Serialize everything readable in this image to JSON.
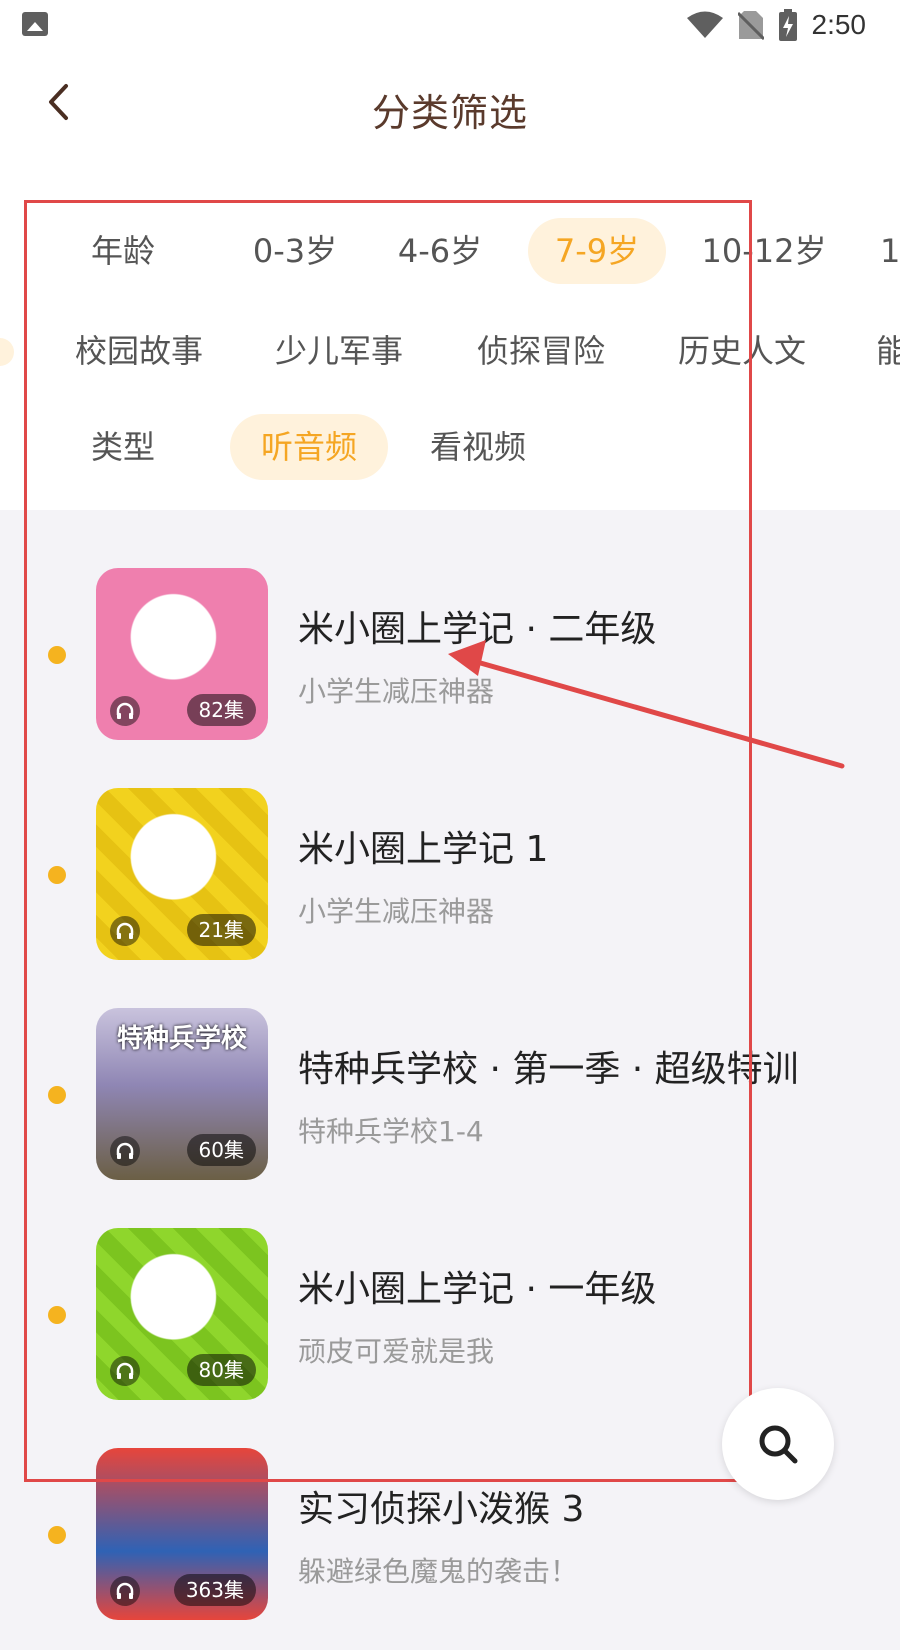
{
  "status_bar": {
    "time": "2:50"
  },
  "header": {
    "title": "分类筛选"
  },
  "filters": {
    "age": {
      "label": "年龄",
      "options": [
        "0-3岁",
        "4-6岁",
        "7-9岁",
        "10-12岁",
        "1"
      ],
      "selected": "7-9岁"
    },
    "topics": {
      "options": [
        "校园故事",
        "少儿军事",
        "侦探冒险",
        "历史人文",
        "能"
      ]
    },
    "type": {
      "label": "类型",
      "options": [
        "听音频",
        "看视频"
      ],
      "selected": "听音频"
    }
  },
  "items": [
    {
      "title": "米小圈上学记 · 二年级",
      "subtitle": "小学生减压神器",
      "episodes": "82集",
      "cover_color": "#ef7fae"
    },
    {
      "title": "米小圈上学记 1",
      "subtitle": "小学生减压神器",
      "episodes": "21集",
      "cover_color": "#f2d21e"
    },
    {
      "title": "特种兵学校 · 第一季 · 超级特训",
      "subtitle": "特种兵学校1-4",
      "episodes": "60集",
      "cover_color": "#8f86b4",
      "cover_title": "特种兵学校"
    },
    {
      "title": "米小圈上学记 · 一年级",
      "subtitle": "顽皮可爱就是我",
      "episodes": "80集",
      "cover_color": "#8fd62c"
    },
    {
      "title": "实习侦探小泼猴 3",
      "subtitle": "躲避绿色魔鬼的袭击！",
      "episodes": "363集",
      "cover_color": "#e7453b"
    }
  ],
  "colors": {
    "accent": "#f5a623",
    "accent_bg": "#fff2dc",
    "annotation": "#e04848"
  }
}
